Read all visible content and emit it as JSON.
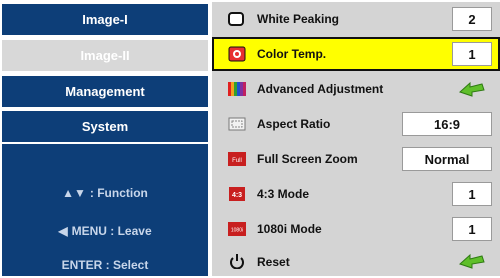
{
  "menu": {
    "tabs": [
      {
        "label": "Image-I",
        "active": false
      },
      {
        "label": "Image-II",
        "active": true
      },
      {
        "label": "Management",
        "active": false
      },
      {
        "label": "System",
        "active": false
      }
    ],
    "hints": [
      {
        "glyph": "▲▼",
        "text": ": Function"
      },
      {
        "glyph": "◀",
        "text": "MENU : Leave"
      },
      {
        "glyph": "",
        "text": "ENTER : Select"
      }
    ]
  },
  "settings": {
    "items": [
      {
        "label": "White Peaking",
        "value": "2",
        "icon": "white-peaking-icon"
      },
      {
        "label": "Color Temp.",
        "value": "1",
        "icon": "thermometer-icon",
        "selected": true
      },
      {
        "label": "Advanced Adjustment",
        "value": "",
        "icon": "color-bars-icon"
      },
      {
        "label": "Aspect Ratio",
        "value": "16:9",
        "icon": "aspect-ratio-icon"
      },
      {
        "label": "Full Screen Zoom",
        "value": "Normal",
        "icon": "full-screen-icon",
        "icon_text": "Full"
      },
      {
        "label": "4:3 Mode",
        "value": "1",
        "icon": "4-3-mode-icon",
        "icon_text": "4:3"
      },
      {
        "label": "1080i Mode",
        "value": "1",
        "icon": "1080i-mode-icon",
        "icon_text": "1080i"
      },
      {
        "label": "Reset",
        "value": "",
        "icon": "power-icon"
      }
    ]
  },
  "colors": {
    "tab_blue": "#0d3e78",
    "active_tab": "#d8d8d8",
    "panel_gray": "#d4d4d4",
    "highlight": "#ffff00",
    "arrow_green": "#5fbf2a"
  }
}
